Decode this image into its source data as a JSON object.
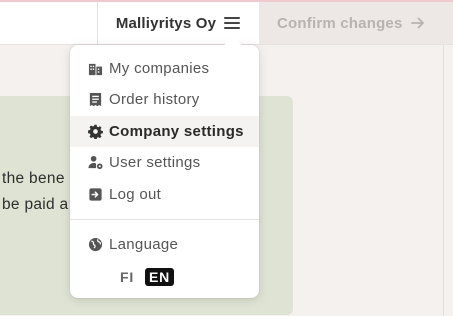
{
  "header": {
    "company_name": "Malliyritys Oy",
    "menu_icon": "hamburger-icon",
    "confirm_label": "Confirm changes",
    "confirm_icon": "arrow-right-icon"
  },
  "content": {
    "line1": "the bene",
    "line2": "be paid a"
  },
  "menu": {
    "items": [
      {
        "label": "My companies",
        "icon": "buildings-icon"
      },
      {
        "label": "Order history",
        "icon": "receipt-icon"
      },
      {
        "label": "Company settings",
        "icon": "gear-icon",
        "active": true
      },
      {
        "label": "User settings",
        "icon": "user-gear-icon"
      },
      {
        "label": "Log out",
        "icon": "logout-icon"
      }
    ],
    "language_label": "Language",
    "language_icon": "globe-icon",
    "languages": [
      {
        "code": "FI",
        "selected": false
      },
      {
        "code": "EN",
        "selected": true
      }
    ]
  },
  "colors": {
    "accent_border": "#f0c9cf",
    "card_background": "#dfe3d3",
    "selected_language_bg": "#111111"
  }
}
